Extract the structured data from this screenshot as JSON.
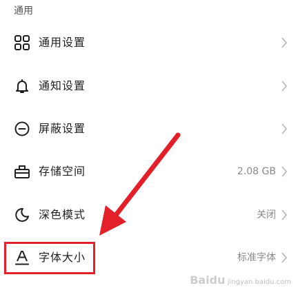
{
  "section": {
    "title": "通用"
  },
  "rows": [
    {
      "label": "通用设置",
      "value": "",
      "icon": "grid-icon"
    },
    {
      "label": "通知设置",
      "value": "",
      "icon": "bell-icon"
    },
    {
      "label": "屏蔽设置",
      "value": "",
      "icon": "block-icon"
    },
    {
      "label": "存储空间",
      "value": "2.08 GB",
      "icon": "storage-icon"
    },
    {
      "label": "深色模式",
      "value": "关闭",
      "icon": "moon-icon"
    },
    {
      "label": "字体大小",
      "value": "标准字体",
      "icon": "font-size-icon"
    }
  ],
  "annotation": {
    "color": "#e3202a"
  },
  "watermark": {
    "brand": "Baidu",
    "sub": "jingyan.baidu.com"
  }
}
